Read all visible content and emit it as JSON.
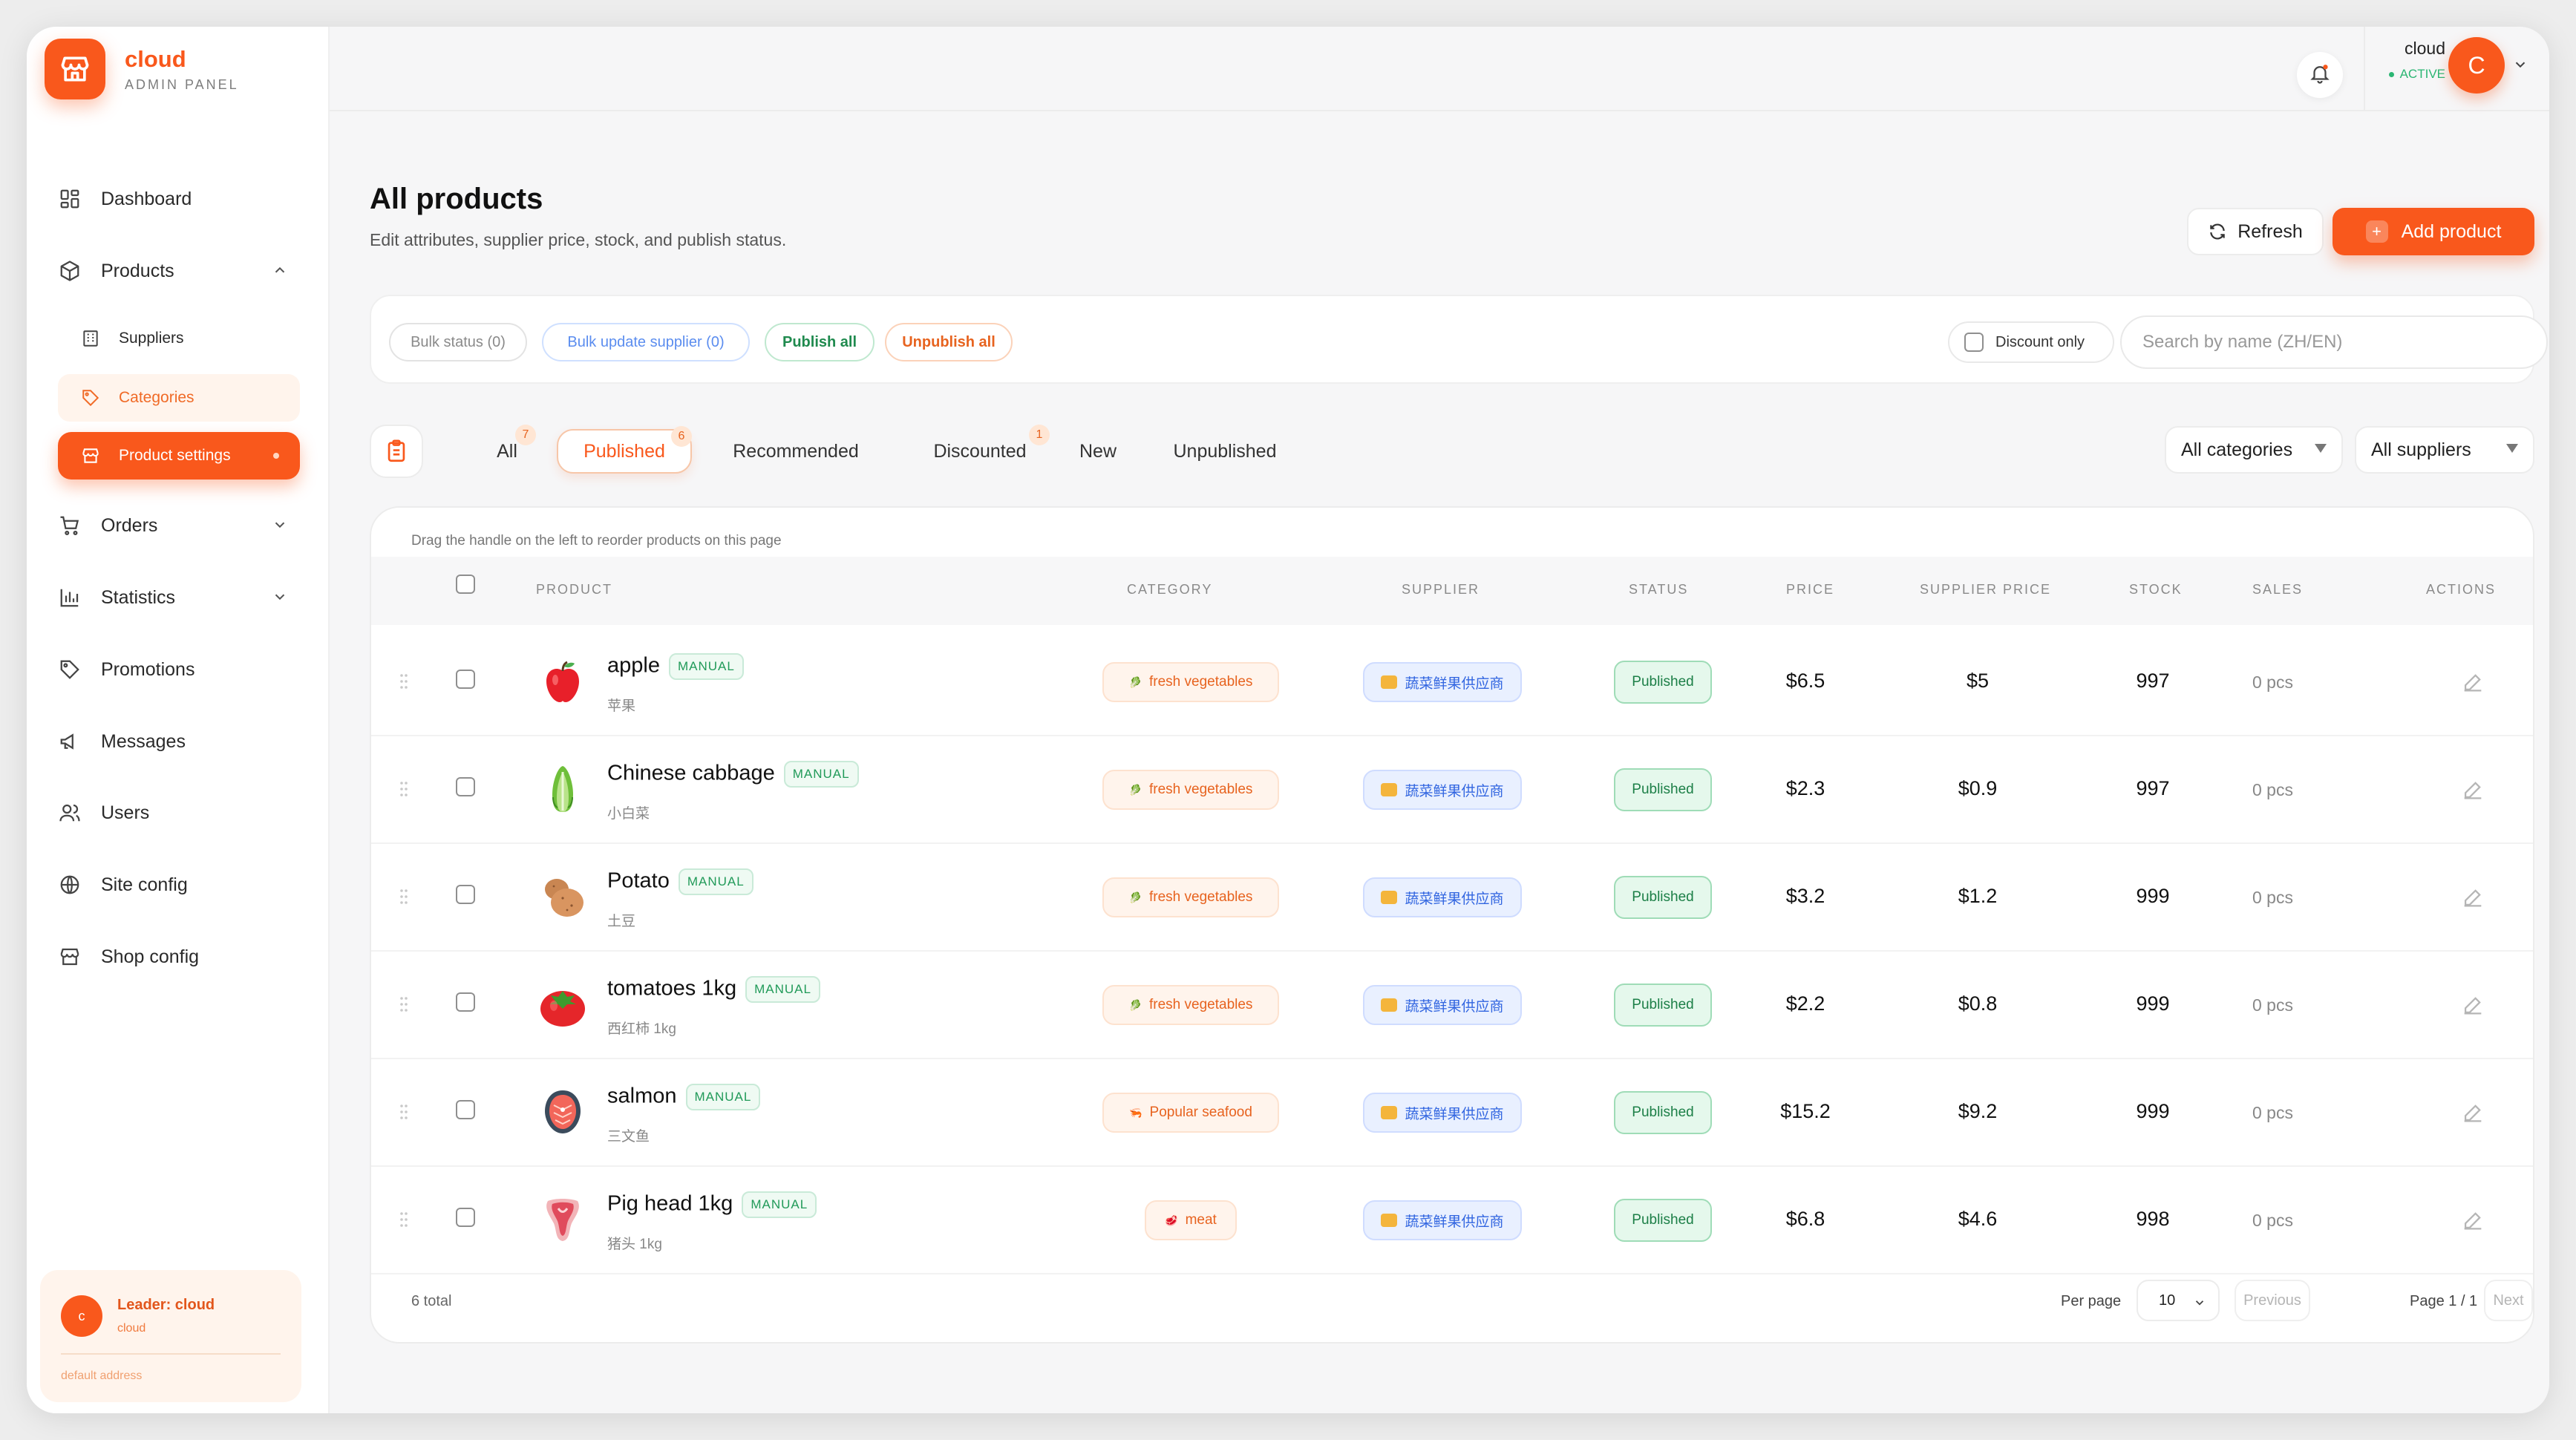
{
  "brand": {
    "name": "cloud",
    "subtitle": "ADMIN PANEL"
  },
  "sidebar": {
    "items": [
      {
        "label": "Dashboard",
        "icon": "dashboard-icon"
      },
      {
        "label": "Products",
        "icon": "box-icon",
        "expanded": true
      },
      {
        "label": "Orders",
        "icon": "cart-icon"
      },
      {
        "label": "Statistics",
        "icon": "bar-chart-icon"
      },
      {
        "label": "Promotions",
        "icon": "tag-icon"
      },
      {
        "label": "Messages",
        "icon": "megaphone-icon"
      },
      {
        "label": "Users",
        "icon": "users-icon"
      },
      {
        "label": "Site config",
        "icon": "globe-icon"
      },
      {
        "label": "Shop config",
        "icon": "store-icon"
      }
    ],
    "sub_items": [
      {
        "label": "Suppliers",
        "icon": "building-icon"
      },
      {
        "label": "Categories",
        "icon": "tag-icon"
      },
      {
        "label": "Product settings",
        "icon": "store-icon",
        "active": true
      }
    ],
    "leader": {
      "avatar": "c",
      "name": "Leader: cloud",
      "sub": "cloud",
      "address": "default address"
    }
  },
  "topbar": {
    "user_name": "cloud",
    "user_status": "ACTIVE",
    "avatar": "C"
  },
  "page": {
    "title": "All products",
    "subtitle": "Edit attributes, supplier price, stock, and publish status.",
    "refresh_label": "Refresh",
    "add_label": "Add product"
  },
  "filters": {
    "bulk_status": "Bulk status (0)",
    "bulk_supplier": "Bulk update supplier (0)",
    "publish_all": "Publish all",
    "unpublish_all": "Unpublish all",
    "discount_only": "Discount only",
    "search_placeholder": "Search by name (ZH/EN)"
  },
  "tabs": [
    {
      "label": "All",
      "badge": "7"
    },
    {
      "label": "Published",
      "badge": "6",
      "active": true
    },
    {
      "label": "Recommended",
      "badge": ""
    },
    {
      "label": "Discounted",
      "badge": "1"
    },
    {
      "label": "New",
      "badge": ""
    },
    {
      "label": "Unpublished",
      "badge": ""
    }
  ],
  "dropdowns": {
    "category": "All categories",
    "supplier": "All suppliers"
  },
  "table": {
    "hint": "Drag the handle on the left to reorder products on this page",
    "headers": {
      "product": "PRODUCT",
      "category": "CATEGORY",
      "supplier": "SUPPLIER",
      "status": "STATUS",
      "price": "PRICE",
      "supplier_price": "SUPPLIER PRICE",
      "stock": "STOCK",
      "sales": "SALES",
      "actions": "ACTIONS"
    },
    "rows": [
      {
        "name": "apple",
        "tag": "MANUAL",
        "sub": "苹果",
        "icon": "apple-icon",
        "category": "fresh vegetables",
        "supplier": "蔬菜鲜果供应商",
        "status": "Published",
        "price": "$6.5",
        "supplier_price": "$5",
        "stock": "997",
        "sales": "0 pcs"
      },
      {
        "name": "Chinese cabbage",
        "tag": "MANUAL",
        "sub": "小白菜",
        "icon": "cabbage-icon",
        "category": "fresh vegetables",
        "supplier": "蔬菜鲜果供应商",
        "status": "Published",
        "price": "$2.3",
        "supplier_price": "$0.9",
        "stock": "997",
        "sales": "0 pcs"
      },
      {
        "name": "Potato",
        "tag": "MANUAL",
        "sub": "土豆",
        "icon": "potato-icon",
        "category": "fresh vegetables",
        "supplier": "蔬菜鲜果供应商",
        "status": "Published",
        "price": "$3.2",
        "supplier_price": "$1.2",
        "stock": "999",
        "sales": "0 pcs"
      },
      {
        "name": "tomatoes 1kg",
        "tag": "MANUAL",
        "sub": "西红柿 1kg",
        "icon": "tomato-icon",
        "category": "fresh vegetables",
        "supplier": "蔬菜鲜果供应商",
        "status": "Published",
        "price": "$2.2",
        "supplier_price": "$0.8",
        "stock": "999",
        "sales": "0 pcs"
      },
      {
        "name": "salmon",
        "tag": "MANUAL",
        "sub": "三文鱼",
        "icon": "salmon-icon",
        "category": "Popular seafood",
        "supplier": "蔬菜鲜果供应商",
        "status": "Published",
        "price": "$15.2",
        "supplier_price": "$9.2",
        "stock": "999",
        "sales": "0 pcs"
      },
      {
        "name": "Pig head 1kg",
        "tag": "MANUAL",
        "sub": "猪头 1kg",
        "icon": "meat-icon",
        "category": "meat",
        "supplier": "蔬菜鲜果供应商",
        "status": "Published",
        "price": "$6.8",
        "supplier_price": "$4.6",
        "stock": "998",
        "sales": "0 pcs"
      }
    ]
  },
  "footer": {
    "total": "6 total",
    "per_page_label": "Per page",
    "per_page": "10",
    "previous": "Previous",
    "page": "Page 1 / 1",
    "next": "Next"
  },
  "colors": {
    "accent": "#f9581c",
    "published_bg": "#e5f8ec",
    "supplier_bg": "#e9f0ff"
  }
}
